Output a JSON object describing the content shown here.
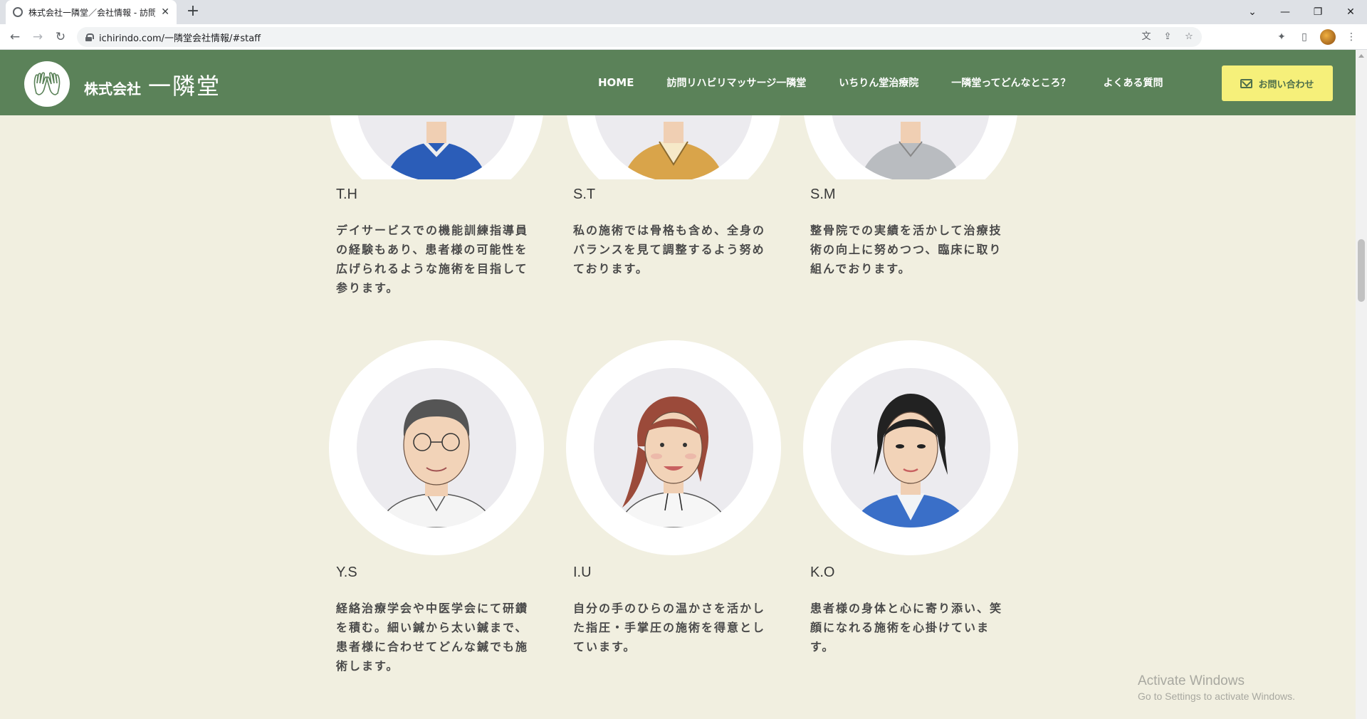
{
  "browser": {
    "tab_title": "株式会社一隣堂／会社情報 - 訪問",
    "url": "ichirindo.com/一隣堂会社情報/#staff"
  },
  "header": {
    "brand_small": "株式会社",
    "brand_large": "一隣堂",
    "nav": [
      "HOME",
      "訪問リハビリマッサージ一隣堂",
      "いちりん堂治療院",
      "一隣堂ってどんなところ？",
      "よくある質問"
    ],
    "contact_label": "お問い合わせ"
  },
  "staff": [
    {
      "name": "T.H",
      "desc": "デイサービスでの機能訓練指導員の経験もあり、患者様の可能性を広げられるような施術を目指して参ります。",
      "shirt_color": "#2b5db8"
    },
    {
      "name": "S.T",
      "desc": "私の施術では骨格も含め、全身のバランスを見て調整するよう努めております。",
      "shirt_color": "#d9a44a"
    },
    {
      "name": "S.M",
      "desc": "整骨院での実績を活かして治療技術の向上に努めつつ、臨床に取り組んでおります。",
      "shirt_color": "#b9bcc0"
    },
    {
      "name": "Y.S",
      "desc": "経絡治療学会や中医学会にて研鑽を積む。細い鍼から太い鍼まで、患者様に合わせてどんな鍼でも施術します。"
    },
    {
      "name": "I.U",
      "desc": "自分の手のひらの温かさを活かした指圧・手掌圧の施術を得意としています。"
    },
    {
      "name": "K.O",
      "desc": "患者様の身体と心に寄り添い、笑顔になれる施術を心掛けています。"
    }
  ],
  "watermark": {
    "title": "Activate Windows",
    "subtitle": "Go to Settings to activate Windows."
  },
  "colors": {
    "header_green": "#5b8259",
    "page_bg": "#f1efe0",
    "contact_yellow": "#f6f07a"
  }
}
